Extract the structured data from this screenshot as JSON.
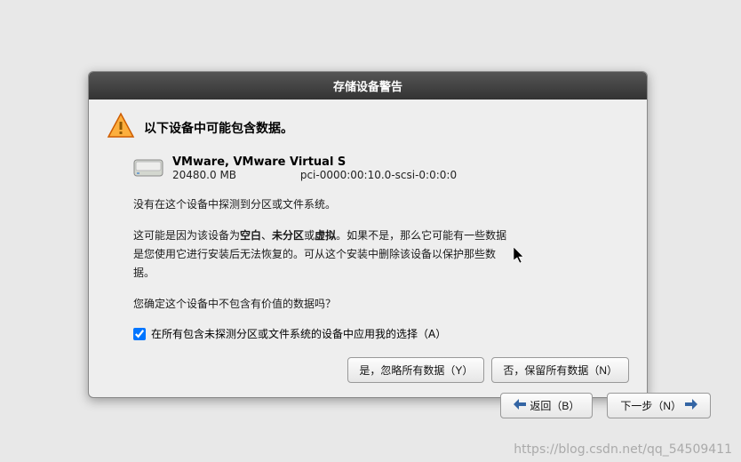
{
  "dialog": {
    "title": "存储设备警告",
    "headline": "以下设备中可能包含数据。",
    "device": {
      "name": "VMware, VMware Virtual S",
      "size": "20480.0 MB",
      "path": "pci-0000:00:10.0-scsi-0:0:0:0"
    },
    "para1": "没有在这个设备中探测到分区或文件系统。",
    "para2_pre": "这可能是因为该设备为",
    "para2_b1": "空白",
    "para2_sep1": "、",
    "para2_b2": "未分区",
    "para2_sep2": "或",
    "para2_b3": "虚拟",
    "para2_rest": "。如果不是，那么它可能有一些数据是您使用它进行安装后无法恢复的。可从这个安装中删除该设备以保护那些数据。",
    "para3": "您确定这个设备中不包含有价值的数据吗？",
    "checkbox_label": "在所有包含未探测分区或文件系统的设备中应用我的选择（A）",
    "buttons": {
      "yes": "是，忽略所有数据（Y）",
      "no": "否，保留所有数据（N）"
    }
  },
  "nav": {
    "back": "返回（B）",
    "next": "下一步（N）"
  },
  "watermark": "https://blog.csdn.net/qq_54509411"
}
